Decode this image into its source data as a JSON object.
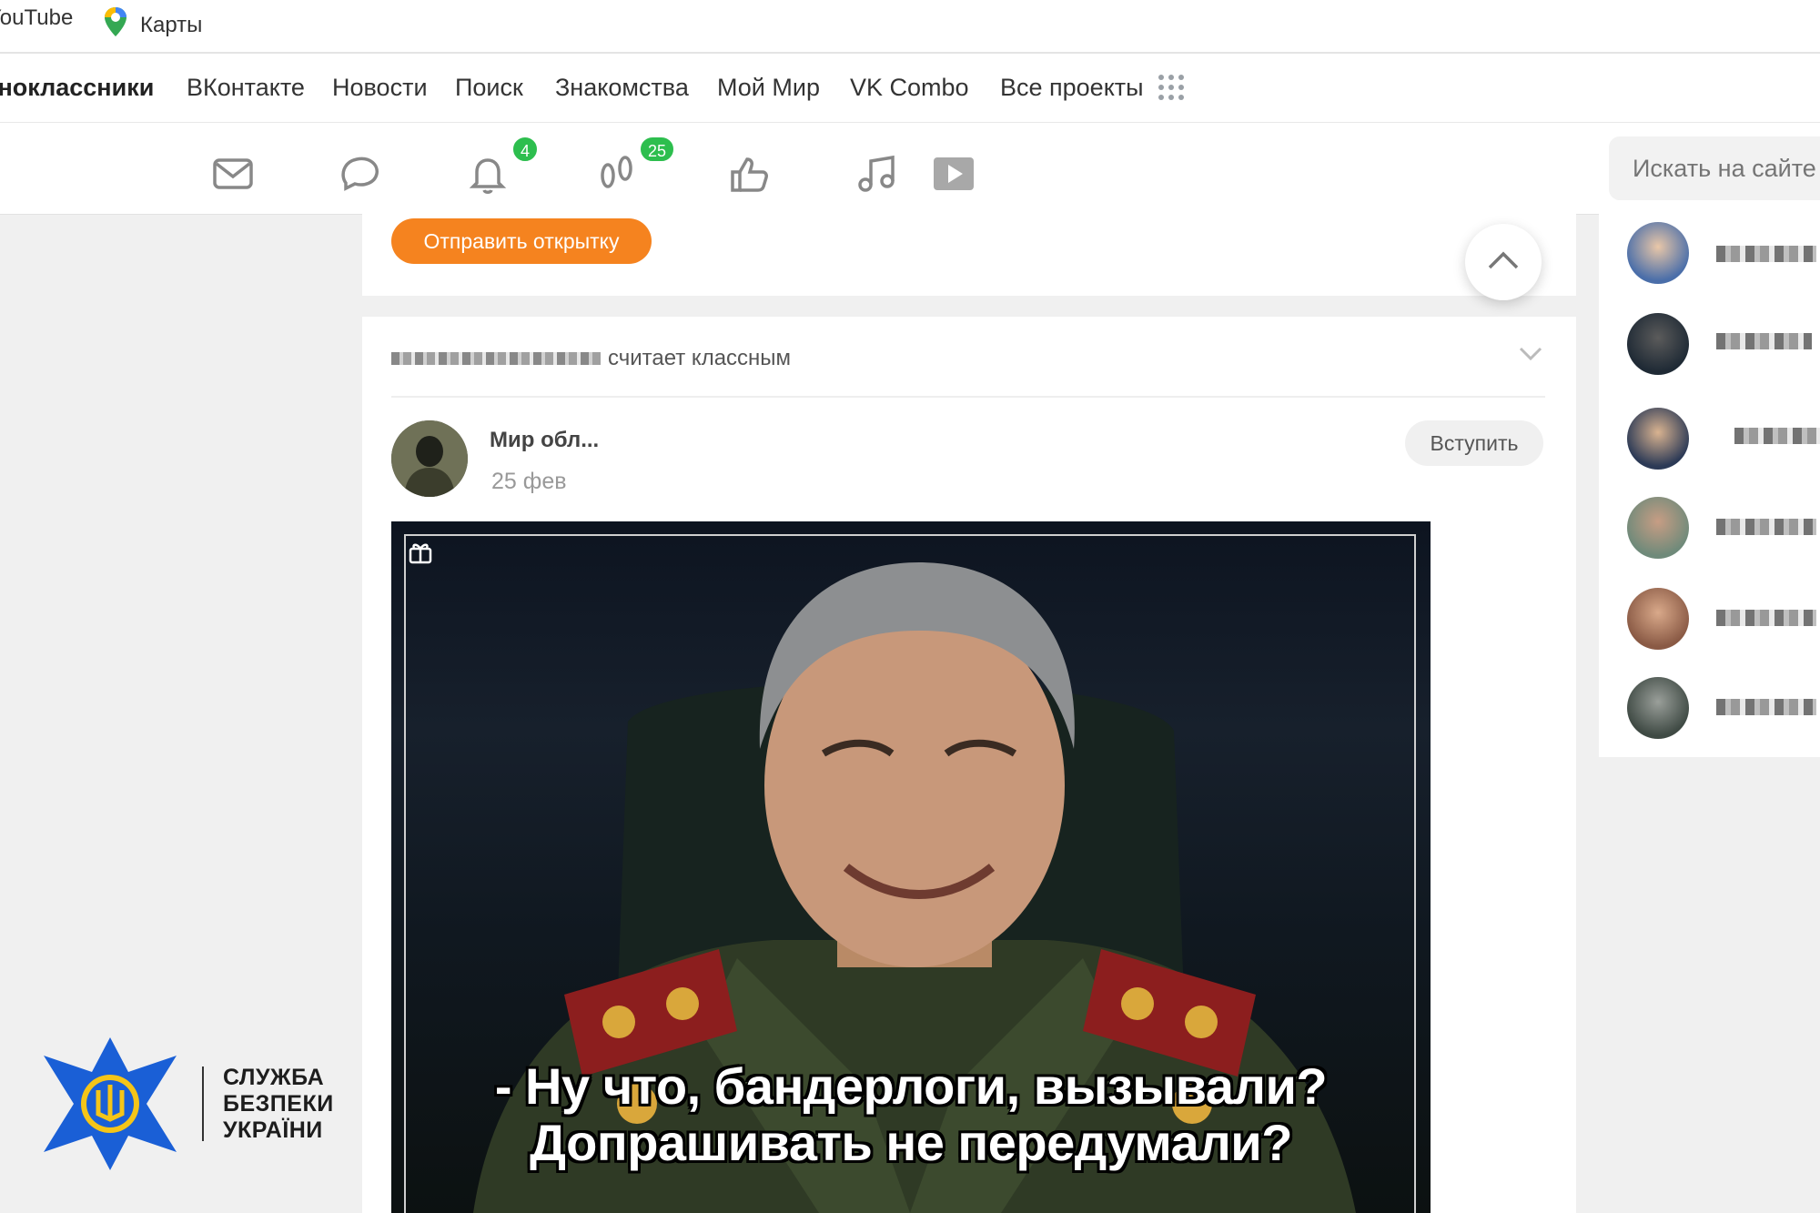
{
  "bookmarks": [
    {
      "label": "YouTube",
      "icon": "youtube-icon"
    },
    {
      "label": "Карты",
      "icon": "maps-pin-icon"
    }
  ],
  "portal_nav": {
    "site_title": "Одноклассники",
    "items": [
      "ВКонтакте",
      "Новости",
      "Поиск",
      "Знакомства",
      "Мой Мир",
      "VK Combo",
      "Все проекты"
    ],
    "apps_icon": "apps-grid-icon"
  },
  "toolbar": {
    "items": [
      {
        "name": "messages",
        "icon": "envelope-icon"
      },
      {
        "name": "discussions",
        "icon": "chat-bubbles-icon"
      },
      {
        "name": "notifications",
        "icon": "bell-icon",
        "badge": "4"
      },
      {
        "name": "guests",
        "icon": "footprints-icon",
        "badge": "25"
      },
      {
        "name": "events",
        "icon": "thumbs-up-icon"
      },
      {
        "name": "music",
        "icon": "music-note-icon"
      },
      {
        "name": "video",
        "icon": "video-play-icon"
      }
    ],
    "search_placeholder": "Искать на сайте",
    "badge_color": "#2dbe4e"
  },
  "feed": {
    "send_card_button": "Отправить открытку",
    "liked_suffix": "считает классным",
    "post": {
      "group_name": "Мир обл...",
      "date": "25 фев",
      "join_button": "Вступить",
      "caption_line1": "- Ну что, бандерлоги, вызывали?",
      "caption_line2": "Допрашивать не передумали?"
    },
    "accent_color": "#f5831f"
  },
  "watermark": {
    "line1": "СЛУЖБА",
    "line2": "БЕЗПЕКИ",
    "line3": "УКРАЇНИ",
    "emblem_color": "#1a5fd6",
    "trident_color": "#f5c518"
  }
}
